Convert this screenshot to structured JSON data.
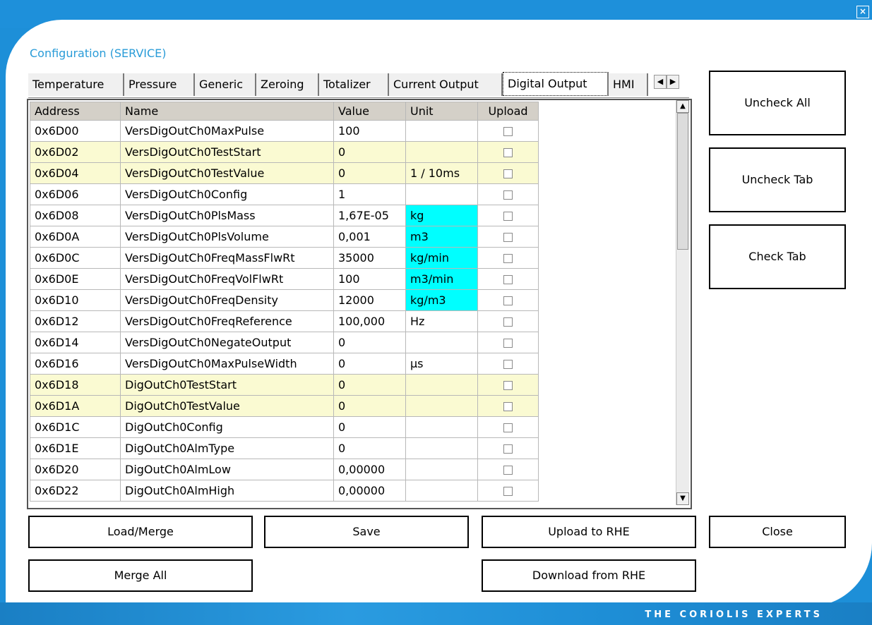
{
  "window": {
    "title": "Configuration (SERVICE)",
    "close_glyph": "×",
    "footer_brand": "THE CORIOLIS EXPERTS"
  },
  "tabs": [
    {
      "label": "Temperature",
      "active": false
    },
    {
      "label": "Pressure",
      "active": false
    },
    {
      "label": "Generic",
      "active": false
    },
    {
      "label": "Zeroing",
      "active": false
    },
    {
      "label": "Totalizer",
      "active": false
    },
    {
      "label": "Current Output",
      "active": false
    },
    {
      "label": "Digital Output",
      "active": true
    },
    {
      "label": "HMI",
      "active": false
    }
  ],
  "tab_scroll": {
    "left_glyph": "◀",
    "right_glyph": "▶"
  },
  "table": {
    "columns": [
      "Address",
      "Name",
      "Value",
      "Unit",
      "Upload"
    ],
    "rows": [
      {
        "address": "0x6D00",
        "name": "VersDigOutCh0MaxPulse",
        "value": "100",
        "unit": "",
        "upload": false,
        "highlight": false,
        "unit_highlight": false
      },
      {
        "address": "0x6D02",
        "name": "VersDigOutCh0TestStart",
        "value": "0",
        "unit": "",
        "upload": false,
        "highlight": true,
        "unit_highlight": false
      },
      {
        "address": "0x6D04",
        "name": "VersDigOutCh0TestValue",
        "value": "0",
        "unit": "1 / 10ms",
        "upload": false,
        "highlight": true,
        "unit_highlight": false
      },
      {
        "address": "0x6D06",
        "name": "VersDigOutCh0Config",
        "value": "1",
        "unit": "",
        "upload": false,
        "highlight": false,
        "unit_highlight": false
      },
      {
        "address": "0x6D08",
        "name": "VersDigOutCh0PlsMass",
        "value": "1,67E-05",
        "unit": "kg",
        "upload": false,
        "highlight": false,
        "unit_highlight": true
      },
      {
        "address": "0x6D0A",
        "name": "VersDigOutCh0PlsVolume",
        "value": "0,001",
        "unit": "m3",
        "upload": false,
        "highlight": false,
        "unit_highlight": true
      },
      {
        "address": "0x6D0C",
        "name": "VersDigOutCh0FreqMassFlwRt",
        "value": "35000",
        "unit": "kg/min",
        "upload": false,
        "highlight": false,
        "unit_highlight": true
      },
      {
        "address": "0x6D0E",
        "name": "VersDigOutCh0FreqVolFlwRt",
        "value": "100",
        "unit": "m3/min",
        "upload": false,
        "highlight": false,
        "unit_highlight": true
      },
      {
        "address": "0x6D10",
        "name": "VersDigOutCh0FreqDensity",
        "value": "12000",
        "unit": "kg/m3",
        "upload": false,
        "highlight": false,
        "unit_highlight": true
      },
      {
        "address": "0x6D12",
        "name": "VersDigOutCh0FreqReference",
        "value": "100,000",
        "unit": "Hz",
        "upload": false,
        "highlight": false,
        "unit_highlight": false
      },
      {
        "address": "0x6D14",
        "name": "VersDigOutCh0NegateOutput",
        "value": "0",
        "unit": "",
        "upload": false,
        "highlight": false,
        "unit_highlight": false
      },
      {
        "address": "0x6D16",
        "name": "VersDigOutCh0MaxPulseWidth",
        "value": "0",
        "unit": "µs",
        "upload": false,
        "highlight": false,
        "unit_highlight": false
      },
      {
        "address": "0x6D18",
        "name": "DigOutCh0TestStart",
        "value": "0",
        "unit": "",
        "upload": false,
        "highlight": true,
        "unit_highlight": false
      },
      {
        "address": "0x6D1A",
        "name": "DigOutCh0TestValue",
        "value": "0",
        "unit": "",
        "upload": false,
        "highlight": true,
        "unit_highlight": false
      },
      {
        "address": "0x6D1C",
        "name": "DigOutCh0Config",
        "value": "0",
        "unit": "",
        "upload": false,
        "highlight": false,
        "unit_highlight": false
      },
      {
        "address": "0x6D1E",
        "name": "DigOutCh0AlmType",
        "value": "0",
        "unit": "",
        "upload": false,
        "highlight": false,
        "unit_highlight": false
      },
      {
        "address": "0x6D20",
        "name": "DigOutCh0AlmLow",
        "value": "0,00000",
        "unit": "",
        "upload": false,
        "highlight": false,
        "unit_highlight": false
      },
      {
        "address": "0x6D22",
        "name": "DigOutCh0AlmHigh",
        "value": "0,00000",
        "unit": "",
        "upload": false,
        "highlight": false,
        "unit_highlight": false
      }
    ]
  },
  "scrollbar": {
    "up_glyph": "▲",
    "down_glyph": "▼"
  },
  "side_buttons": {
    "uncheck_all": "Uncheck All",
    "uncheck_tab": "Uncheck Tab",
    "check_tab": "Check Tab"
  },
  "bottom_buttons": {
    "load_merge": "Load/Merge",
    "save": "Save",
    "upload_to_rhe": "Upload to RHE",
    "close": "Close",
    "merge_all": "Merge All",
    "download_from_rhe": "Download from RHE"
  },
  "colors": {
    "accent": "#1e90da",
    "title_text": "#2a9cd8",
    "row_highlight": "#fafad2",
    "unit_highlight": "#00ffff"
  }
}
